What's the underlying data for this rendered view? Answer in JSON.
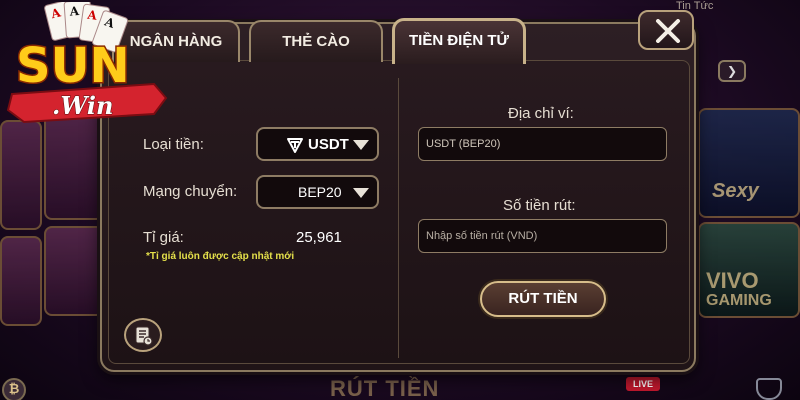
{
  "background": {
    "top_right_link": "Tin Tức",
    "bottom_banner": "RÚT TIỀN",
    "live_badge": "LIVE",
    "tile_sexy": "Sexy",
    "tile_gaming": "GAMING",
    "tile_vivo": "VIVO"
  },
  "logo": {
    "brand_top": "SUN",
    "brand_bottom": ".Win",
    "icon": "playing-cards-icon"
  },
  "tabs": [
    {
      "label": "NGÂN HÀNG",
      "active": false
    },
    {
      "label": "THẺ CÀO",
      "active": false
    },
    {
      "label": "TIỀN ĐIỆN TỬ",
      "active": true
    }
  ],
  "form": {
    "currency_label": "Loại tiền:",
    "currency_value": "USDT",
    "currency_icon": "tether-icon",
    "network_label": "Mạng chuyển:",
    "network_value": "BEP20",
    "rate_label": "Tỉ giá:",
    "rate_value": "25,961",
    "rate_note": "*Tỉ giá luôn được cập nhật mới",
    "wallet_label": "Địa chỉ ví:",
    "wallet_value": "USDT (BEP20)",
    "amount_label": "Số tiền rút:",
    "amount_placeholder": "Nhập số tiền rút (VND)",
    "submit_label": "RÚT TIỀN"
  },
  "colors": {
    "accent_gold": "#c8b28a",
    "note_yellow": "#e4e04a",
    "panel_bg": "#201417"
  }
}
